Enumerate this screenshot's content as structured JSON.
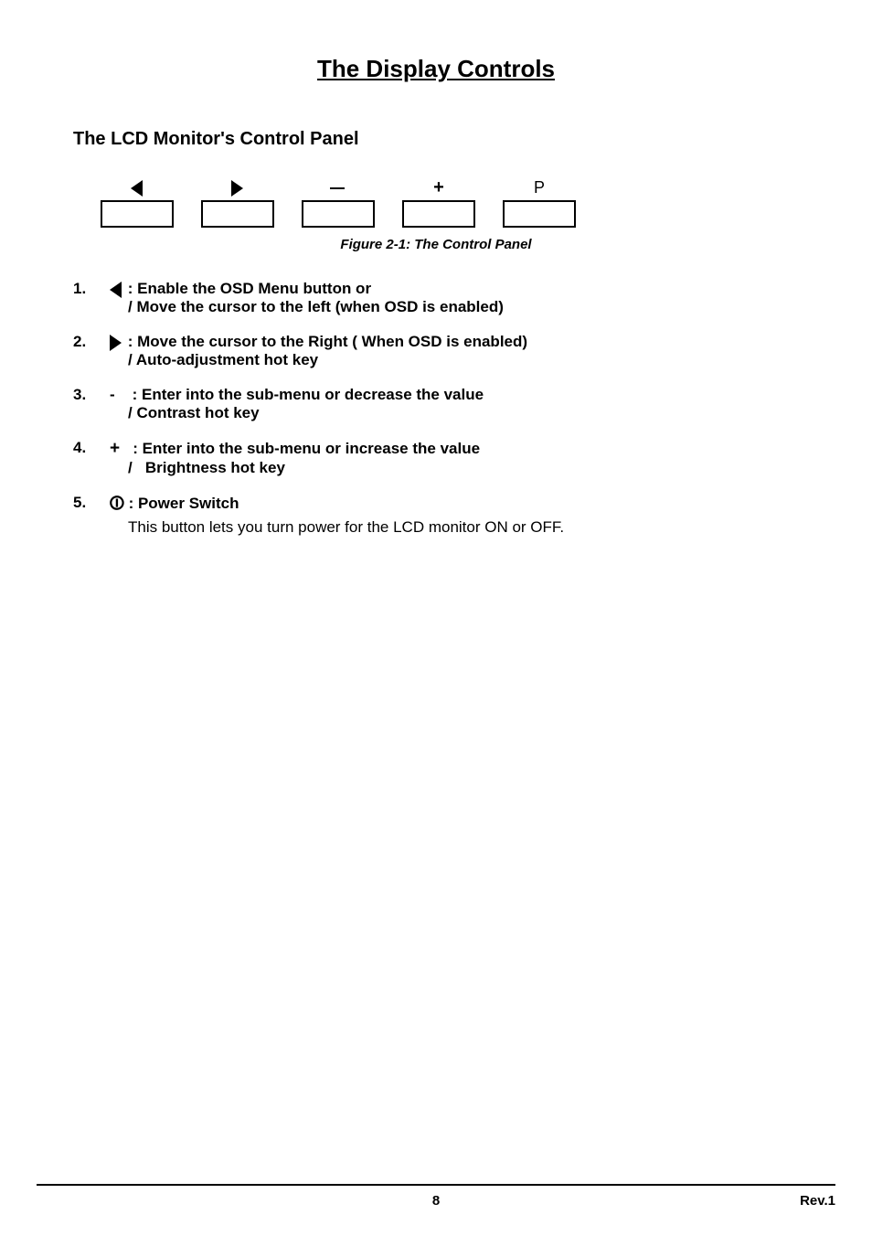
{
  "page": {
    "title": "The Display Controls",
    "section_title": "The LCD Monitor's Control Panel",
    "figure_caption": "Figure 2-1: The Control Panel",
    "buttons": [
      {
        "symbol": "◁",
        "type": "triangle-left"
      },
      {
        "symbol": "▷",
        "type": "triangle-right"
      },
      {
        "symbol": "—",
        "type": "dash"
      },
      {
        "symbol": "+",
        "type": "plus"
      },
      {
        "symbol": "P",
        "type": "power"
      }
    ],
    "items": [
      {
        "number": "1.",
        "symbol": "triangle-left",
        "line1": ": Enable the OSD Menu button or",
        "line2": "/ Move the cursor to the left (when OSD is enabled)"
      },
      {
        "number": "2.",
        "symbol": "triangle-right",
        "line1": ": Move the cursor to the Right ( When OSD is enabled)",
        "line2": "/ Auto-adjustment hot key"
      },
      {
        "number": "3.",
        "symbol": "dash",
        "line1": ":  Enter into the sub-menu or decrease the value",
        "line2": "/ Contrast hot key"
      },
      {
        "number": "4.",
        "symbol": "plus",
        "line1": ": Enter into the sub-menu or increase the value",
        "line2": "/  Brightness hot key"
      },
      {
        "number": "5.",
        "symbol": "power",
        "line1": ": Power Switch",
        "description": "This button lets you turn power for the LCD monitor ON or OFF."
      }
    ],
    "footer": {
      "page_number": "8",
      "revision": "Rev.1"
    }
  }
}
